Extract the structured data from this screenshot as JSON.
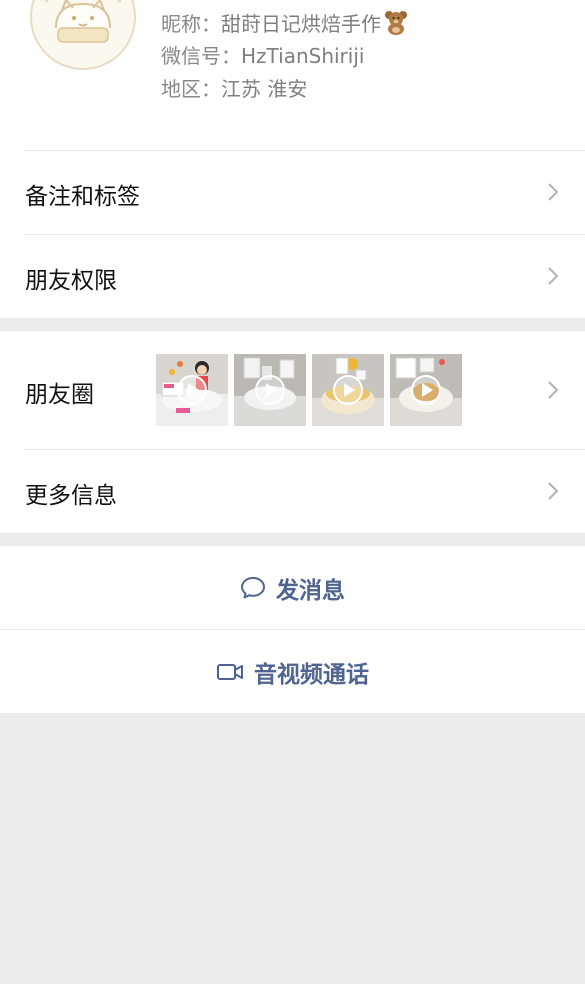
{
  "profile": {
    "nickname_label": "昵称：",
    "nickname": "甜莳日记烘焙手作",
    "wechat_id_label": "微信号：",
    "wechat_id": "HzTianShiriji",
    "region_label": "地区：",
    "region": "江苏 淮安"
  },
  "menu": {
    "remark_tags": "备注和标签",
    "friend_permissions": "朋友权限",
    "moments": "朋友圈",
    "more_info": "更多信息"
  },
  "actions": {
    "send_message": "发消息",
    "video_call": "音视频通话"
  },
  "colors": {
    "accent": "#4f6491",
    "background": "#ededed",
    "card": "#ffffff"
  },
  "icons": {
    "chevron": "chevron-right-icon",
    "chat": "chat-bubble-icon",
    "video": "video-camera-icon",
    "play": "play-icon"
  }
}
